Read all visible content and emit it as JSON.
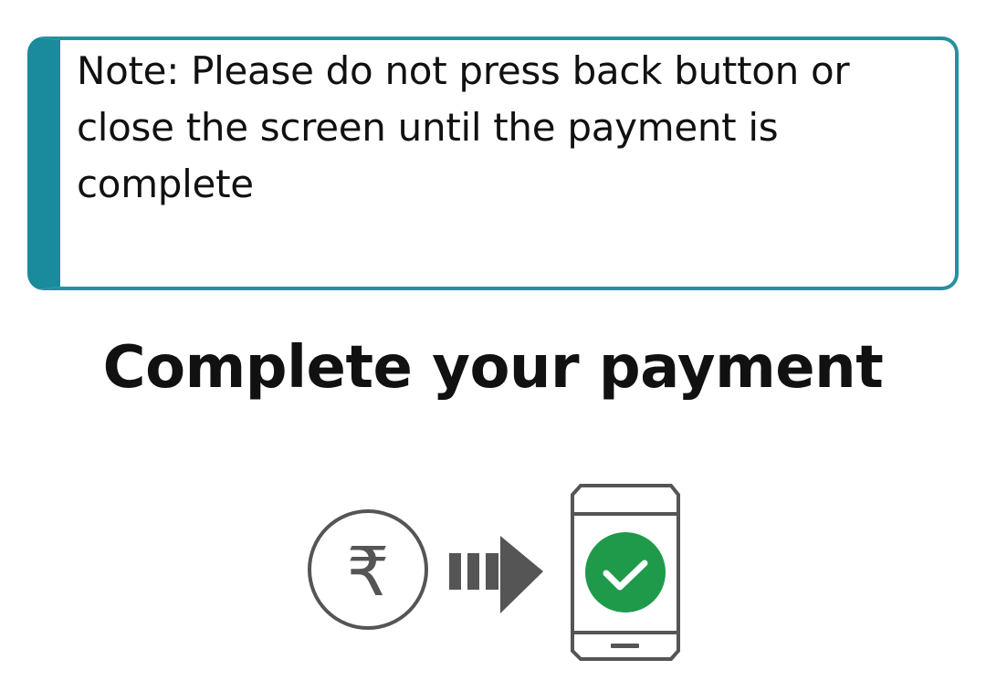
{
  "note": {
    "text": "Note: Please do not press back button or close the screen until the payment is complete"
  },
  "heading": {
    "text": "Complete your payment"
  },
  "illustration": {
    "icons": [
      "rupee-icon",
      "arrow-right-icon",
      "phone-icon",
      "check-circle-icon"
    ],
    "currency_symbol": "₹",
    "colors": {
      "accent": "#1a8a9d",
      "icon_gray": "#555555",
      "success_green": "#1f9a4a"
    }
  }
}
